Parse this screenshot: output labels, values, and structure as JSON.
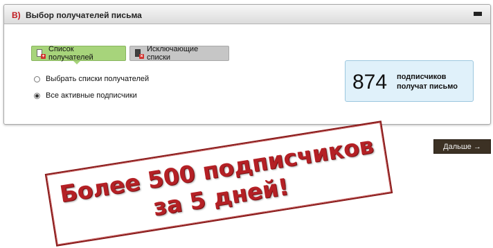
{
  "panel": {
    "step": "В)",
    "title": "Выбор получателей письма"
  },
  "tabs": [
    {
      "label": "Список получателей",
      "active": true
    },
    {
      "label": "Исключающие списки",
      "active": false
    }
  ],
  "options": [
    {
      "label": "Выбрать списки получателей",
      "checked": false
    },
    {
      "label": "Все активные подписчики",
      "checked": true
    }
  ],
  "counter": {
    "count": "874",
    "line1": "подписчиков",
    "line2": "получат письмо"
  },
  "next_label": "Дальше →",
  "banner": {
    "line1": "Более 500 подписчиков",
    "line2": "за 5 дней!"
  },
  "colors": {
    "accent_red": "#c0191f",
    "tab_active": "#a7d47b",
    "counter_bg": "#e0f1fa",
    "next_bg": "#3c3124",
    "banner_text": "#b42025"
  },
  "icons": [
    "collapse-icon",
    "recipient-list-icon",
    "exclude-list-icon"
  ]
}
